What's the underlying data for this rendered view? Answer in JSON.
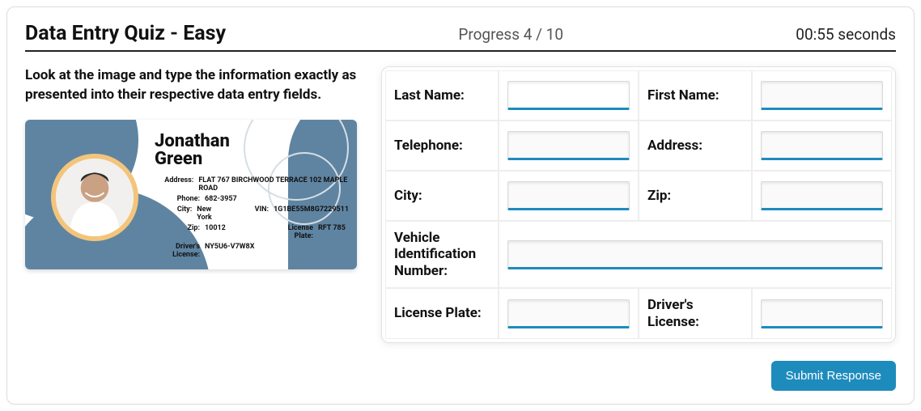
{
  "header": {
    "title": "Data Entry Quiz - Easy",
    "progress": "Progress 4 / 10",
    "timer": "00:55 seconds"
  },
  "instruction": "Look at the image and type the information exactly as presented into their respective data entry fields.",
  "card": {
    "name_first": "Jonathan",
    "name_last": "Green",
    "labels": {
      "address": "Address:",
      "phone": "Phone:",
      "city": "City:",
      "zip": "Zip:",
      "drivers": "Driver's License:",
      "vin": "VIN:",
      "plate": "License Plate:"
    },
    "values": {
      "address": "FLAT 767 BIRCHWOOD TERRACE 102 MAPLE ROAD",
      "phone": "682-3957",
      "city": "New York",
      "zip": "10012",
      "drivers": "NY5U6-V7W8X",
      "vin": "1G1BE55M8G7229511",
      "plate": "RFT 785"
    }
  },
  "form": {
    "labels": {
      "last_name": "Last Name:",
      "first_name": "First Name:",
      "telephone": "Telephone:",
      "address": "Address:",
      "city": "City:",
      "zip": "Zip:",
      "vin": "Vehicle Identification Number:",
      "plate": "License Plate:",
      "drivers": "Driver's License:"
    },
    "values": {
      "last_name": "",
      "first_name": "",
      "telephone": "",
      "address": "",
      "city": "",
      "zip": "",
      "vin": "",
      "plate": "",
      "drivers": ""
    }
  },
  "buttons": {
    "submit": "Submit Response"
  }
}
